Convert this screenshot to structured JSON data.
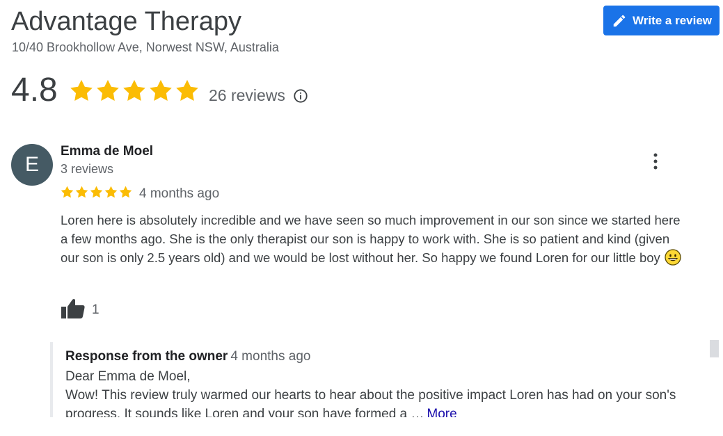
{
  "business": {
    "name": "Advantage Therapy",
    "address": "10/40 Brookhollow Ave, Norwest NSW, Australia",
    "rating": "4.8",
    "stars": 5,
    "reviews_count": "26 reviews"
  },
  "write_review": {
    "label": "Write a review"
  },
  "review": {
    "avatar_letter": "E",
    "reviewer": "Emma de Moel",
    "reviewer_reviews": "3 reviews",
    "stars": 5,
    "time": "4 months ago",
    "text": "Loren here is absolutely incredible and we have seen so much improvement in our son since we started here a few months ago. She is the only therapist our son is happy to work with. She is so patient and kind (given our son is only 2.5 years old) and we would be lost without her. So happy we found Loren for our little boy",
    "likes": "1"
  },
  "owner_response": {
    "label": "Response from the owner",
    "time": "4 months ago",
    "greeting": "Dear Emma de Moel,",
    "text": "Wow! This review truly warmed our hearts to hear about the positive impact Loren has had on your son's progress. It sounds like Loren and your son have formed a …",
    "more_label": "More"
  },
  "colors": {
    "star": "#fbbc04",
    "accent": "#1a73e8",
    "avatar": "#455a64"
  }
}
